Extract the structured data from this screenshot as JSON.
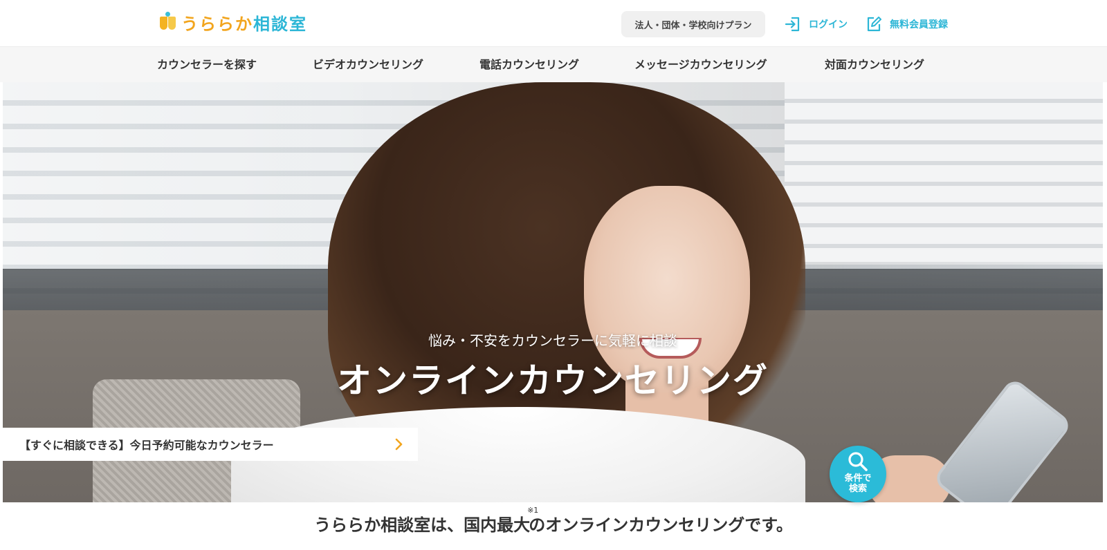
{
  "header": {
    "logo_text_part1": "うらら",
    "logo_text_part2": "か",
    "logo_text_part3": "相談室",
    "plan_button": "法人・団体・学校向けプラン",
    "login_label": "ログイン",
    "register_label": "無料会員登録",
    "accent_color": "#2cb6d6",
    "logo_accent_color": "#f2a51e"
  },
  "nav": {
    "items": [
      {
        "label": "カウンセラーを探す"
      },
      {
        "label": "ビデオカウンセリング"
      },
      {
        "label": "電話カウンセリング"
      },
      {
        "label": "メッセージカウンセリング"
      },
      {
        "label": "対面カウンセリング"
      }
    ]
  },
  "hero": {
    "tagline": "悩み・不安をカウンセラーに気軽に相談",
    "title": "オンラインカウンセリング",
    "today_bar": "【すぐに相談できる】今日予約可能なカウンセラー",
    "search_fab_line1": "条件で",
    "search_fab_line2": "検索"
  },
  "intro": {
    "text_before": "うららか相談室は、国内最大",
    "superscript": "※1",
    "text_after": "のオンラインカウンセリングです。"
  },
  "icons": {
    "logo": "logo-book-icon",
    "login": "login-arrow-icon",
    "register": "edit-pencil-icon",
    "chevron": "chevron-right-icon",
    "search": "search-magnifier-icon"
  }
}
